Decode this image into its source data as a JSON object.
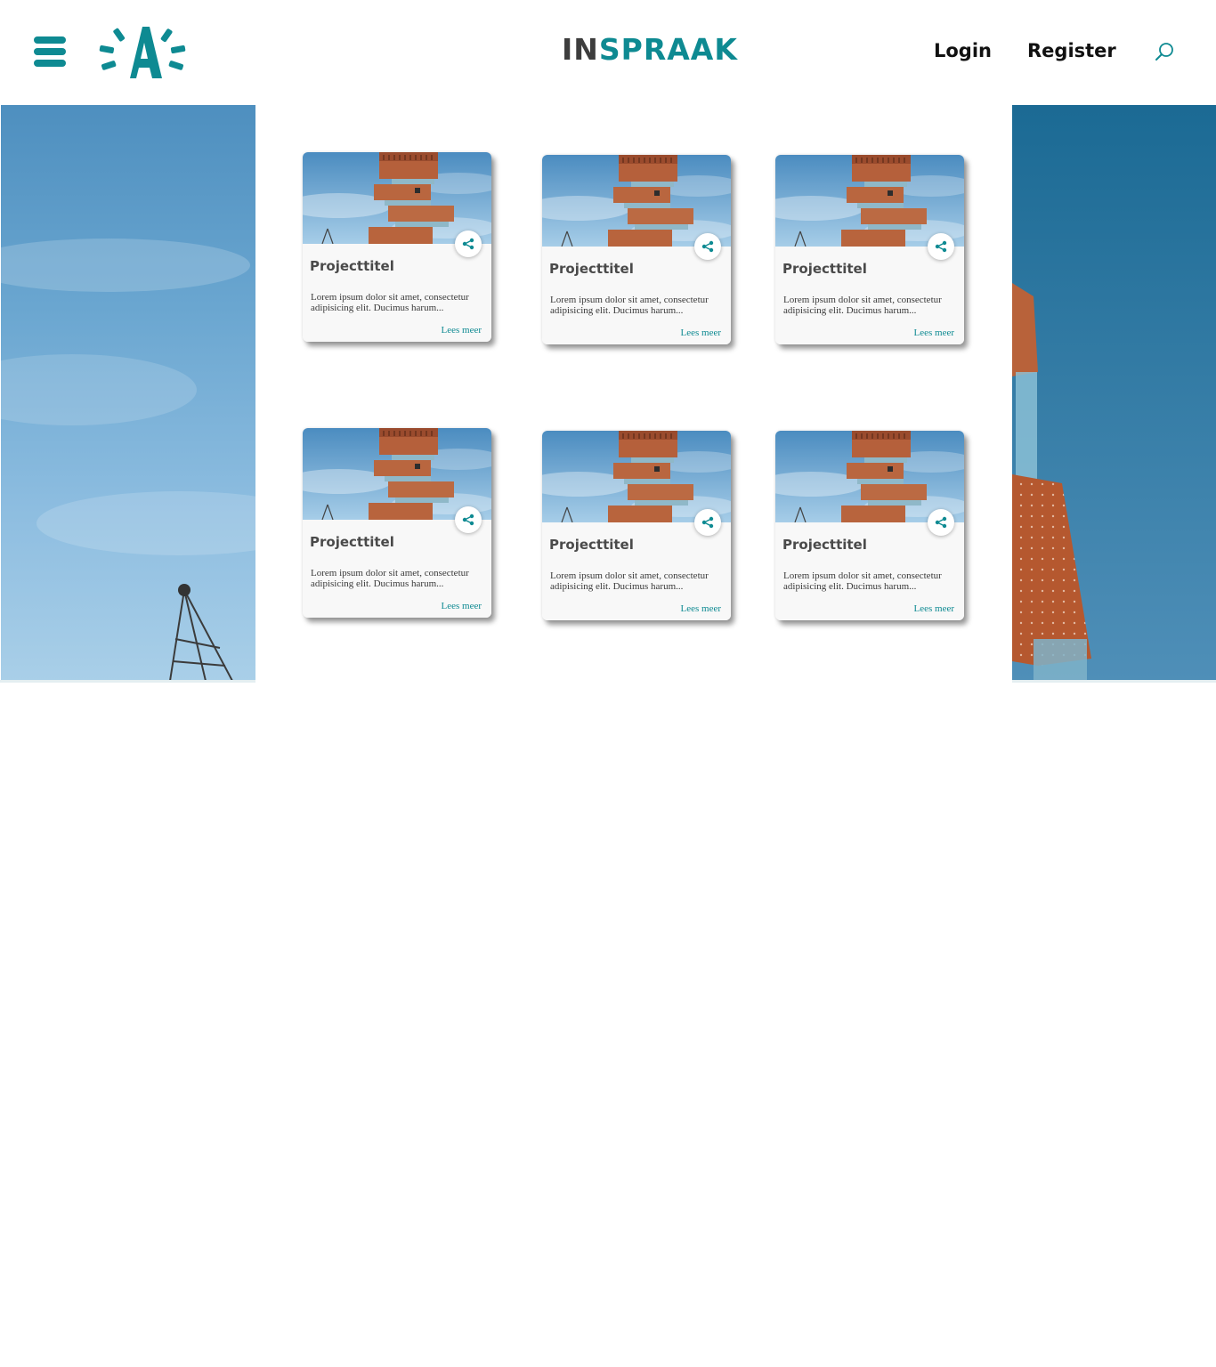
{
  "header": {
    "brand_part1": "IN",
    "brand_part2": "SPRAAK",
    "login_label": "Login",
    "register_label": "Register"
  },
  "colors": {
    "accent": "#0e8a92",
    "brand_dark": "#3d3d3d"
  },
  "projects": [
    {
      "title": "Projecttitel",
      "excerpt": "Lorem ipsum dolor sit amet, consectetur adipisicing elit. Ducimus harum...",
      "link_label": "Lees meer"
    },
    {
      "title": "Projecttitel",
      "excerpt": "Lorem ipsum dolor sit amet, consectetur adipisicing elit. Ducimus harum...",
      "link_label": "Lees meer"
    },
    {
      "title": "Projecttitel",
      "excerpt": "Lorem ipsum dolor sit amet, consectetur adipisicing elit. Ducimus harum...",
      "link_label": "Lees meer"
    },
    {
      "title": "Projecttitel",
      "excerpt": "Lorem ipsum dolor sit amet, consectetur adipisicing elit. Ducimus harum...",
      "link_label": "Lees meer"
    },
    {
      "title": "Projecttitel",
      "excerpt": "Lorem ipsum dolor sit amet, consectetur adipisicing elit. Ducimus harum...",
      "link_label": "Lees meer"
    },
    {
      "title": "Projecttitel",
      "excerpt": "Lorem ipsum dolor sit amet, consectetur adipisicing elit. Ducimus harum...",
      "link_label": "Lees meer"
    }
  ]
}
